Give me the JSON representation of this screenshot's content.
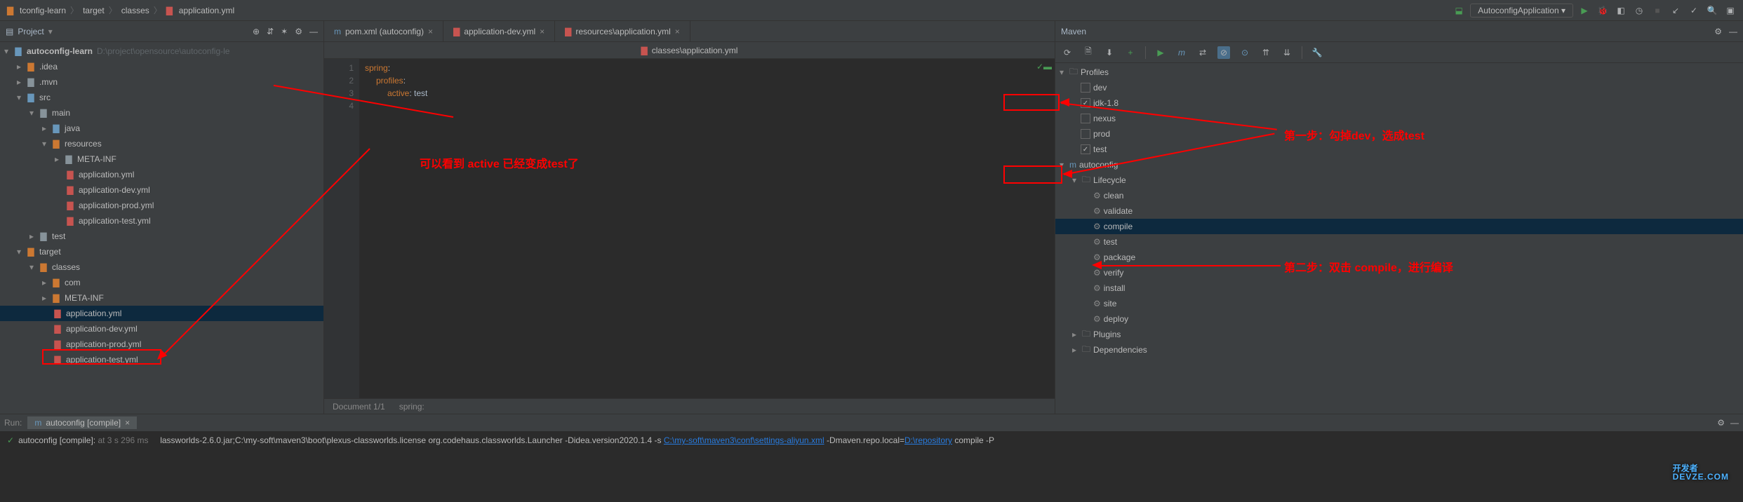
{
  "breadcrumb": {
    "items": [
      "tconfig-learn",
      "target",
      "classes",
      "application.yml"
    ]
  },
  "runconfig": {
    "label": "AutoconfigApplication ▾"
  },
  "project": {
    "title": "Project",
    "root": {
      "name": "autoconfig-learn",
      "path": "D:\\project\\opensource\\autoconfig-le"
    },
    "nodes": {
      "idea": ".idea",
      "mvn": ".mvn",
      "src": "src",
      "main": "main",
      "java": "java",
      "resources": "resources",
      "metainf": "META-INF",
      "appyml": "application.yml",
      "appdev": "application-dev.yml",
      "appprod": "application-prod.yml",
      "apptest": "application-test.yml",
      "test": "test",
      "target": "target",
      "classes": "classes",
      "com": "com",
      "metainf2": "META-INF",
      "t_appyml": "application.yml",
      "t_appdev": "application-dev.yml",
      "t_appprod": "application-prod.yml",
      "t_apptest": "application-test.yml"
    }
  },
  "editor": {
    "tabs": [
      {
        "label": "pom.xml (autoconfig)"
      },
      {
        "label": "application-dev.yml"
      },
      {
        "label": "resources\\application.yml"
      }
    ],
    "fileheader": "classes\\application.yml",
    "code": {
      "lines": [
        "1",
        "2",
        "3",
        "4"
      ],
      "l1k": "spring",
      "l1c": ":",
      "l2k": "profiles",
      "l2c": ":",
      "l3k": "active",
      "l3c": ": ",
      "l3v": "test"
    },
    "status": {
      "doc": "Document 1/1",
      "ctx": "spring:"
    }
  },
  "maven": {
    "title": "Maven",
    "profiles": "Profiles",
    "prof": {
      "dev": "dev",
      "jdk": "jdk-1.8",
      "nexus": "nexus",
      "prod": "prod",
      "test": "test"
    },
    "module": "autoconfig",
    "lifecycle": "Lifecycle",
    "goals": {
      "clean": "clean",
      "validate": "validate",
      "compile": "compile",
      "test": "test",
      "package": "package",
      "verify": "verify",
      "install": "install",
      "site": "site",
      "deploy": "deploy"
    },
    "plugins": "Plugins",
    "deps": "Dependencies"
  },
  "run": {
    "label": "Run:",
    "tab": "autoconfig [compile]",
    "line_prefix": "autoconfig [compile]:",
    "line_time": "at 3 s 296 ms",
    "line_body1": "lassworlds-2.6.0.jar;C:\\my-soft\\maven3\\boot\\plexus-classworlds.license org.codehaus.classworlds.Launcher -Didea.version2020.1.4 -s ",
    "line_link": "C:\\my-soft\\maven3\\conf\\settings-aliyun.xml",
    "line_body2": " -Dmaven.repo.local=",
    "line_link2": "D:\\repository",
    "line_body3": " compile -P"
  },
  "annotations": {
    "a1": "可以看到 active 已经变成test了",
    "a2": "第一步：勾掉dev，选成test",
    "a3": "第二步：双击 compile，进行编译"
  },
  "watermark": {
    "top": "开发者",
    "sub": "DEVZE.COM"
  }
}
